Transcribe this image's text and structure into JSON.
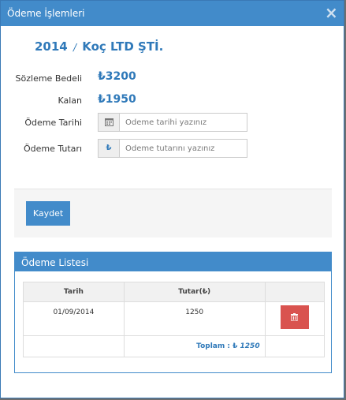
{
  "modal": {
    "title": "Ödeme İşlemleri",
    "close_glyph": "×"
  },
  "heading": {
    "year": "2014",
    "separator": "/",
    "company": "Koç LTD ŞTİ."
  },
  "summary": {
    "contract_label": "Sözleme Bedeli",
    "contract_value": "₺3200",
    "remaining_label": "Kalan",
    "remaining_value": "₺1950"
  },
  "form": {
    "date_label": "Ödeme Tarihi",
    "date_placeholder": "Ödeme tarihi yazınız",
    "date_icon": "calendar-icon",
    "amount_label": "Ödeme Tutarı",
    "amount_placeholder": "Ödeme tutarını yazınız",
    "amount_icon_glyph": "₺",
    "save_label": "Kaydet"
  },
  "payments": {
    "title": "Ödeme Listesi",
    "columns": [
      "Tarih",
      "Tutar(₺)",
      ""
    ],
    "rows": [
      {
        "date": "01/09/2014",
        "amount": "1250"
      }
    ],
    "total_label": "Toplam : ₺",
    "total_value": "1250"
  },
  "colors": {
    "primary": "#428bca",
    "accent_text": "#2f79b9",
    "danger": "#d9534f"
  }
}
